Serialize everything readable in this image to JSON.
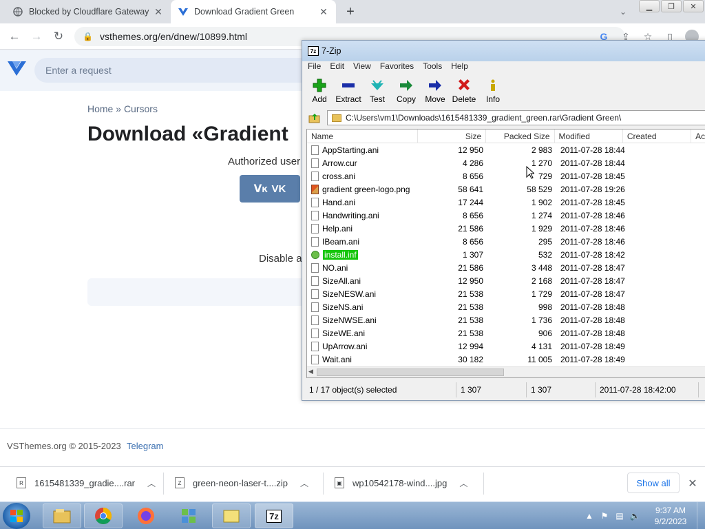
{
  "tabs": [
    {
      "title": "Blocked by Cloudflare Gateway",
      "icon": "globe-icon",
      "active": false
    },
    {
      "title": "Download Gradient Green",
      "icon": "vsthemes-icon",
      "active": true
    }
  ],
  "address": {
    "url": "vsthemes.org/en/dnew/10899.html"
  },
  "site": {
    "search_placeholder": "Enter a request",
    "breadcrumb_home": "Home",
    "breadcrumb_sep": "»",
    "breadcrumb_section": "Cursors",
    "title": "Download «Gradient",
    "authorized_text": "Authorized user",
    "vk_label": "VK",
    "disable_text": "Disable a",
    "footer_copy": "VSThemes.org © 2015-2023",
    "footer_link": "Telegram"
  },
  "zip": {
    "title": "7-Zip",
    "menu": [
      "File",
      "Edit",
      "View",
      "Favorites",
      "Tools",
      "Help"
    ],
    "tools": [
      {
        "label": "Add",
        "icon": "add-icon",
        "color": "#19a319"
      },
      {
        "label": "Extract",
        "icon": "extract-icon",
        "color": "#1a2ea8"
      },
      {
        "label": "Test",
        "icon": "test-icon",
        "color": "#1fb4b4"
      },
      {
        "label": "Copy",
        "icon": "copy-icon",
        "color": "#1a8a3a"
      },
      {
        "label": "Move",
        "icon": "move-icon",
        "color": "#1a2ea8"
      },
      {
        "label": "Delete",
        "icon": "delete-icon",
        "color": "#d11a1a"
      },
      {
        "label": "Info",
        "icon": "info-icon",
        "color": "#c8a800"
      }
    ],
    "path": "C:\\Users\\vm1\\Downloads\\1615481339_gradient_green.rar\\Gradient Green\\",
    "columns": [
      "Name",
      "Size",
      "Packed Size",
      "Modified",
      "Created",
      "Ac"
    ],
    "files": [
      {
        "name": "AppStarting.ani",
        "size": "12 950",
        "packed": "2 983",
        "modified": "2011-07-28 18:44",
        "type": "file"
      },
      {
        "name": "Arrow.cur",
        "size": "4 286",
        "packed": "1 270",
        "modified": "2011-07-28 18:44",
        "type": "file"
      },
      {
        "name": "cross.ani",
        "size": "8 656",
        "packed": "729",
        "modified": "2011-07-28 18:45",
        "type": "file"
      },
      {
        "name": "gradient green-logo.png",
        "size": "58 641",
        "packed": "58 529",
        "modified": "2011-07-28 19:26",
        "type": "png"
      },
      {
        "name": "Hand.ani",
        "size": "17 244",
        "packed": "1 902",
        "modified": "2011-07-28 18:45",
        "type": "file"
      },
      {
        "name": "Handwriting.ani",
        "size": "8 656",
        "packed": "1 274",
        "modified": "2011-07-28 18:46",
        "type": "file"
      },
      {
        "name": "Help.ani",
        "size": "21 586",
        "packed": "1 929",
        "modified": "2011-07-28 18:46",
        "type": "file"
      },
      {
        "name": "IBeam.ani",
        "size": "8 656",
        "packed": "295",
        "modified": "2011-07-28 18:46",
        "type": "file"
      },
      {
        "name": "install.inf",
        "size": "1 307",
        "packed": "532",
        "modified": "2011-07-28 18:42",
        "type": "inf",
        "selected": true
      },
      {
        "name": "NO.ani",
        "size": "21 586",
        "packed": "3 448",
        "modified": "2011-07-28 18:47",
        "type": "file"
      },
      {
        "name": "SizeAll.ani",
        "size": "12 950",
        "packed": "2 168",
        "modified": "2011-07-28 18:47",
        "type": "file"
      },
      {
        "name": "SizeNESW.ani",
        "size": "21 538",
        "packed": "1 729",
        "modified": "2011-07-28 18:47",
        "type": "file"
      },
      {
        "name": "SizeNS.ani",
        "size": "21 538",
        "packed": "998",
        "modified": "2011-07-28 18:48",
        "type": "file"
      },
      {
        "name": "SizeNWSE.ani",
        "size": "21 538",
        "packed": "1 736",
        "modified": "2011-07-28 18:48",
        "type": "file"
      },
      {
        "name": "SizeWE.ani",
        "size": "21 538",
        "packed": "906",
        "modified": "2011-07-28 18:48",
        "type": "file"
      },
      {
        "name": "UpArrow.ani",
        "size": "12 994",
        "packed": "4 131",
        "modified": "2011-07-28 18:49",
        "type": "file"
      },
      {
        "name": "Wait.ani",
        "size": "30 182",
        "packed": "11 005",
        "modified": "2011-07-28 18:49",
        "type": "file"
      }
    ],
    "status": {
      "selected": "1 / 17 object(s) selected",
      "size": "1 307",
      "packed": "1 307",
      "modified": "2011-07-28 18:42:00"
    }
  },
  "downloads": [
    {
      "name": "1615481339_gradie....rar",
      "icon": "rar-file-icon"
    },
    {
      "name": "green-neon-laser-t....zip",
      "icon": "zip-file-icon"
    },
    {
      "name": "wp10542178-wind....jpg",
      "icon": "image-file-icon"
    }
  ],
  "show_all": "Show all",
  "clock": {
    "time": "9:37 AM",
    "date": "9/2/2023"
  }
}
